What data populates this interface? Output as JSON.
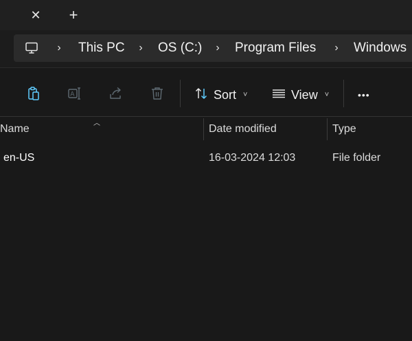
{
  "titlebar": {
    "close_tab_glyph": "✕",
    "new_tab_glyph": "+"
  },
  "address": {
    "icon": "monitor-icon",
    "breadcrumbs": [
      "This PC",
      "OS (C:)",
      "Program Files",
      "Windows"
    ],
    "separator_glyph": "›"
  },
  "toolbar": {
    "icons": [
      "paste-icon",
      "rename-icon",
      "share-icon",
      "delete-icon"
    ],
    "sort_label": "Sort",
    "view_label": "View",
    "more_glyph": "•••",
    "caret_glyph": "˅"
  },
  "columns": {
    "name": "Name",
    "date_modified": "Date modified",
    "type": "Type"
  },
  "files": [
    {
      "name": "en-US",
      "date_modified": "16-03-2024 12:03",
      "type": "File folder"
    }
  ],
  "colors": {
    "background": "#191919",
    "titlebar": "#202020",
    "addressbar": "#2b2b2b",
    "accent_icon": "#60cdff",
    "text": "#ffffff"
  }
}
